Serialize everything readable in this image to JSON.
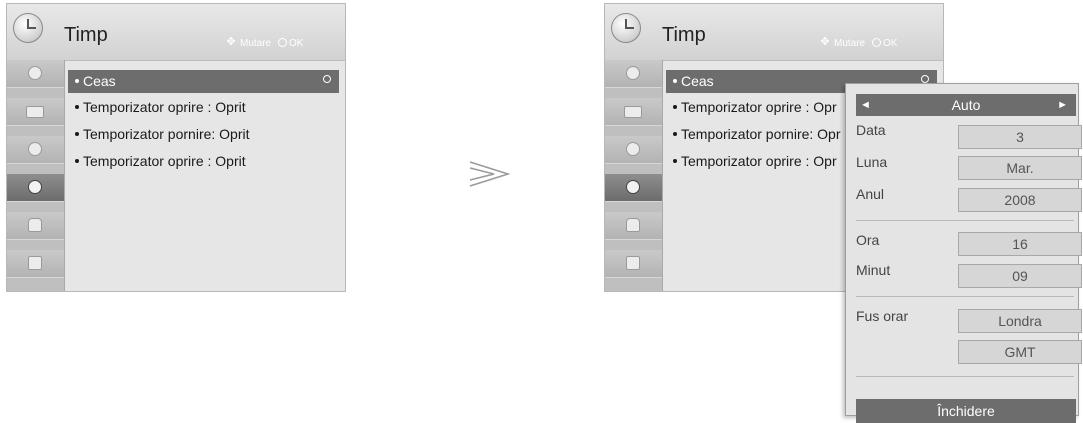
{
  "left_menu": {
    "title": "Timp",
    "hint_move": "Mutare",
    "hint_ok": "OK",
    "items": [
      {
        "label": "Ceas"
      },
      {
        "label": "Temporizator oprire  : Oprit"
      },
      {
        "label": "Temporizator pornire: Oprit"
      },
      {
        "label": "Temporizator oprire  : Oprit"
      }
    ]
  },
  "right_menu": {
    "title": "Timp",
    "hint_move": "Mutare",
    "hint_ok": "OK",
    "items": [
      {
        "label": "Ceas"
      },
      {
        "label": "Temporizator oprire  : Opr"
      },
      {
        "label": "Temporizator pornire: Opr"
      },
      {
        "label": "Temporizator oprire  : Opr"
      }
    ]
  },
  "side_icons": [
    "picture-icon",
    "tv-icon",
    "audio-icon",
    "clock-icon",
    "lock-icon",
    "option-icon"
  ],
  "arrow_symbol": "≫",
  "popup": {
    "mode": "Auto",
    "left_arrow": "◄",
    "right_arrow": "►",
    "date_label": "Data",
    "date_value": "3",
    "month_label": "Luna",
    "month_value": "Mar.",
    "year_label": "Anul",
    "year_value": "2008",
    "hour_label": "Ora",
    "hour_value": "16",
    "minute_label": "Minut",
    "minute_value": "09",
    "timezone_label": "Fus orar",
    "timezone_value": "Londra",
    "gmt_value": "GMT",
    "close_label": "Închidere"
  }
}
